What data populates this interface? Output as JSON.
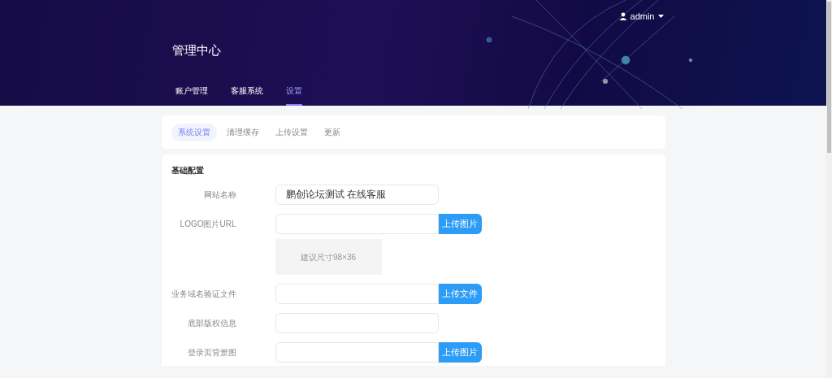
{
  "header": {
    "title": "管理中心",
    "user": "admin",
    "nav": [
      {
        "label": "账户管理",
        "selected": false
      },
      {
        "label": "客服系统",
        "selected": false
      },
      {
        "label": "设置",
        "selected": true
      }
    ]
  },
  "tabs": [
    {
      "label": "系统设置",
      "selected": true
    },
    {
      "label": "清理缓存",
      "selected": false
    },
    {
      "label": "上传设置",
      "selected": false
    },
    {
      "label": "更新",
      "selected": false
    }
  ],
  "section": {
    "title": "基础配置",
    "fields": [
      {
        "kind": "text",
        "label": "网站名称",
        "value": "鹏创论坛测试 在线客服"
      },
      {
        "kind": "upload",
        "label": "LOGO图片URL",
        "button": "上传图片",
        "preview": "建议尺寸98×36"
      },
      {
        "kind": "upload",
        "label": "业务域名验证文件",
        "button": "上传文件"
      },
      {
        "kind": "text",
        "label": "底部版权信息"
      },
      {
        "kind": "upload",
        "label": "登录页背景图",
        "button": "上传图片"
      }
    ]
  }
}
